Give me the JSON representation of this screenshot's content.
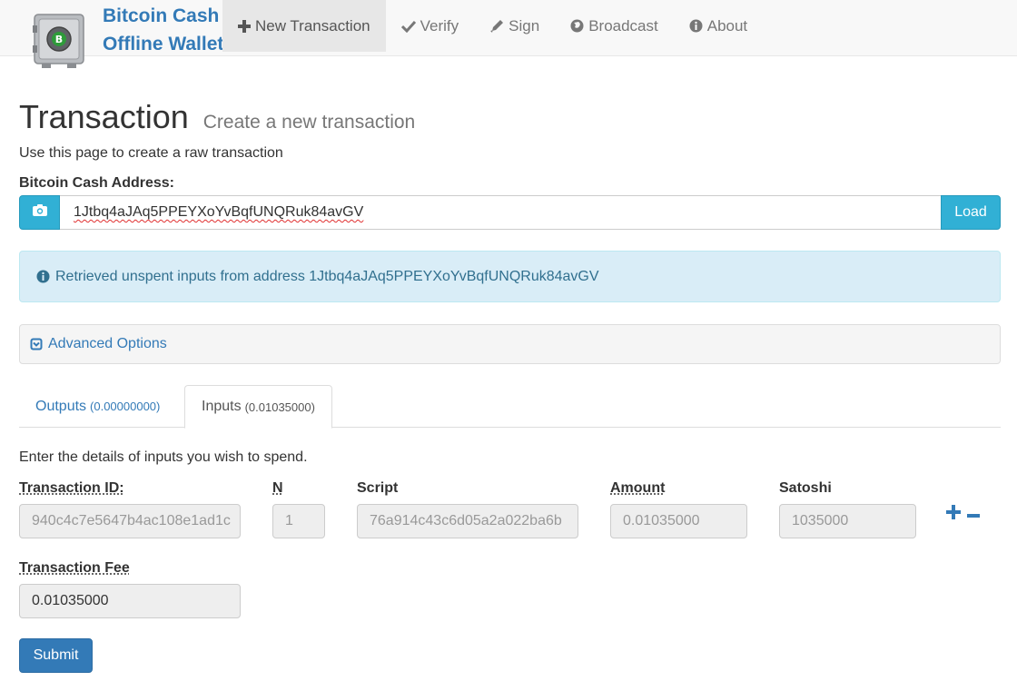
{
  "colors": {
    "brand": "#337ab7",
    "info": "#31b0d5",
    "alert_bg": "#d9edf7",
    "alert_text": "#31708f"
  },
  "navbar": {
    "brand_line1": "Bitcoin Cash",
    "brand_line2": "Offline Wallet",
    "items": [
      {
        "label": "New Transaction",
        "icon": "plus-icon",
        "active": true
      },
      {
        "label": "Verify",
        "icon": "check-icon"
      },
      {
        "label": "Sign",
        "icon": "pencil-icon"
      },
      {
        "label": "Broadcast",
        "icon": "globe-icon"
      },
      {
        "label": "About",
        "icon": "info-circle-icon"
      }
    ]
  },
  "page": {
    "title": "Transaction",
    "subtitle": "Create a new transaction",
    "intro": "Use this page to create a raw transaction"
  },
  "address": {
    "label": "Bitcoin Cash Address:",
    "value": "1Jtbq4aJAq5PPEYXoYvBqfUNQRuk84avGV",
    "load_label": "Load",
    "camera_icon": "camera-icon"
  },
  "alert": {
    "text": "Retrieved unspent inputs from address 1Jtbq4aJAq5PPEYXoYvBqfUNQRuk84avGV"
  },
  "advanced": {
    "label": "Advanced Options"
  },
  "tabs": {
    "outputs": {
      "label": "Outputs",
      "amount": "(0.00000000)"
    },
    "inputs": {
      "label": "Inputs",
      "amount": "(0.01035000)",
      "active": true
    }
  },
  "inputs_section": {
    "intro": "Enter the details of inputs you wish to spend.",
    "columns": {
      "txid": "Transaction ID:",
      "n": "N",
      "script": "Script",
      "amount": "Amount",
      "satoshi": "Satoshi"
    },
    "row": {
      "txid": "940c4c7e5647b4ac108e1ad1c",
      "n": "1",
      "script": "76a914c43c6d05a2a022ba6b",
      "amount": "0.01035000",
      "satoshi": "1035000"
    }
  },
  "fee": {
    "label": "Transaction Fee",
    "value": "0.01035000"
  },
  "submit_label": "Submit"
}
